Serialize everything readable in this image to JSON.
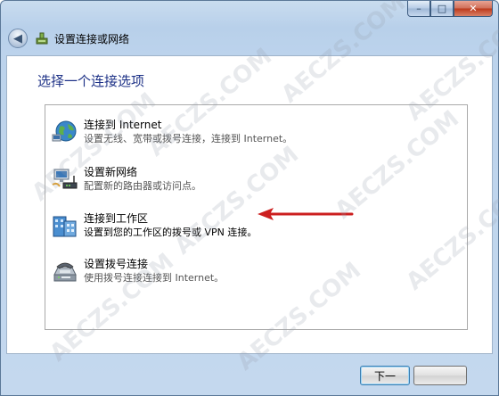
{
  "window": {
    "title": "设置连接或网络",
    "controls": {
      "minimize": "–",
      "maximize": "□",
      "close": "✕"
    }
  },
  "nav": {
    "back_label": "◀"
  },
  "main": {
    "heading": "选择一个连接选项",
    "options": [
      {
        "title": "连接到 Internet",
        "description": "设置无线、宽带或拨号连接，连接到 Internet。",
        "icon": "internet-globe-icon"
      },
      {
        "title": "设置新网络",
        "description": "配置新的路由器或访问点。",
        "icon": "network-router-icon"
      },
      {
        "title": "连接到工作区",
        "description": "设置到您的工作区的拨号或 VPN 连接。",
        "icon": "workplace-building-icon",
        "selected": true
      },
      {
        "title": "设置拨号连接",
        "description": "使用拨号连接连接到 Internet。",
        "icon": "dialup-modem-icon"
      }
    ]
  },
  "footer": {
    "next_label": "下一",
    "cancel_label": ""
  },
  "watermark": "AECZS.COM",
  "colors": {
    "heading": "#1e3287",
    "annotation_arrow": "#cc1f1f",
    "frame": "#bcd3ec"
  }
}
